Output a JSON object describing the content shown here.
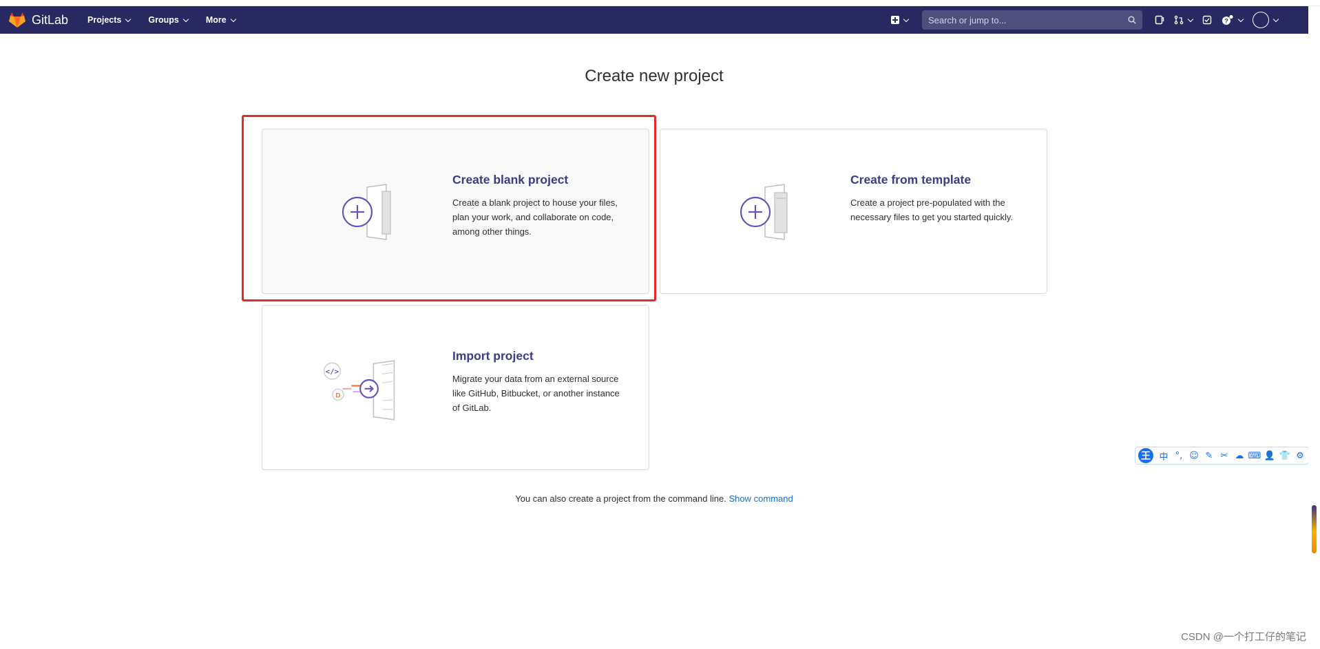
{
  "navbar": {
    "brand": "GitLab",
    "menu": [
      {
        "label": "Projects"
      },
      {
        "label": "Groups"
      },
      {
        "label": "More"
      }
    ],
    "search_placeholder": "Search or jump to...",
    "bg_color": "#292961"
  },
  "page": {
    "title": "Create new project"
  },
  "cards": [
    {
      "title": "Create blank project",
      "description": "Create a blank project to house your files, plan your work, and collaborate on code, among other things.",
      "icon": "blank-project-icon",
      "selected": true
    },
    {
      "title": "Create from template",
      "description": "Create a project pre-populated with the necessary files to get you started quickly.",
      "icon": "template-project-icon"
    },
    {
      "title": "Import project",
      "description": "Migrate your data from an external source like GitHub, Bitbucket, or another instance of GitLab.",
      "icon": "import-project-icon"
    }
  ],
  "cmdline": {
    "text": "You can also create a project from the command line.",
    "link": "Show command"
  },
  "ime_toolbar": {
    "logo": "王",
    "items": [
      "中",
      "°,",
      "☺",
      "✎",
      "✂",
      "☁",
      "⌨",
      "👤",
      "👕",
      "⚙"
    ]
  },
  "watermark": "CSDN @一个打工仔的笔记",
  "colors": {
    "accent_title": "#3c3c86",
    "link": "#1f6fc5",
    "highlight": "#e52a2a"
  }
}
